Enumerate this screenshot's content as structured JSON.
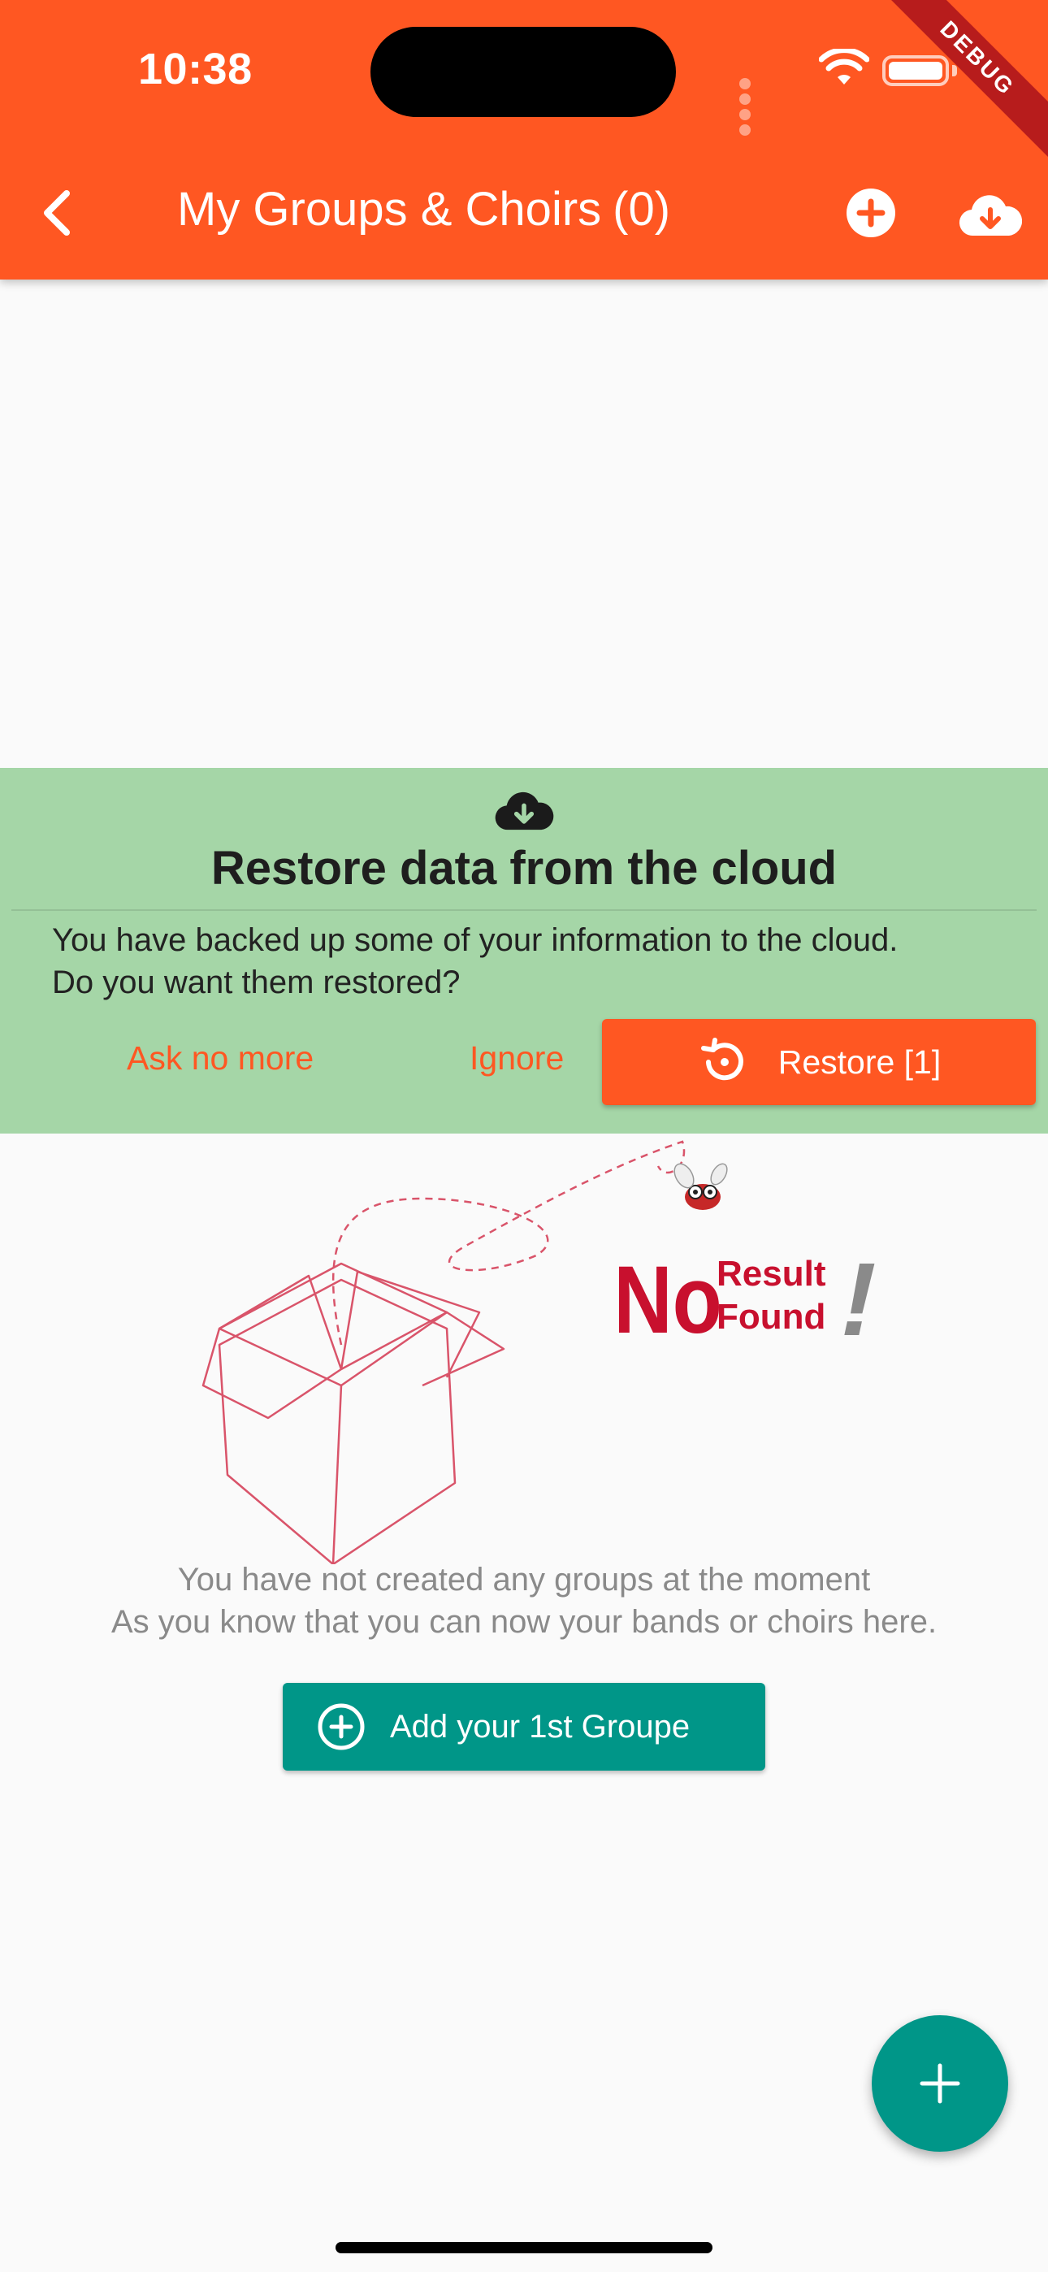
{
  "status_bar": {
    "time": "10:38"
  },
  "debug_banner": "DEBUG",
  "app_bar": {
    "title": "My Groups & Choirs",
    "count": "(0)",
    "back_icon": "chevron-left-icon",
    "add_icon": "plus-circle-icon",
    "cloud_icon": "cloud-download-icon"
  },
  "restore_banner": {
    "icon": "cloud-download-icon",
    "title": "Restore data from the cloud",
    "message_line1": "You have backed up some of your information to the cloud.",
    "message_line2": "Do you want them restored?",
    "ask_no_more_label": "Ask no more",
    "ignore_label": "Ignore",
    "restore_label": "Restore [1]",
    "restore_icon": "restore-icon",
    "background": "#a5d6a7"
  },
  "empty_state": {
    "illustration_word_big": "No",
    "illustration_word_1": "Result",
    "illustration_word_2": "Found",
    "illustration_mark": "!",
    "line1": "You have not created any groups at the moment",
    "line2": "As you know that you can now your bands or choirs here.",
    "add_button_label": "Add your 1st Groupe",
    "add_button_icon": "plus-circle-icon"
  },
  "fab": {
    "icon": "plus-icon"
  },
  "colors": {
    "primary": "#ff5722",
    "accent": "#009688",
    "debug": "#b71c1c"
  }
}
